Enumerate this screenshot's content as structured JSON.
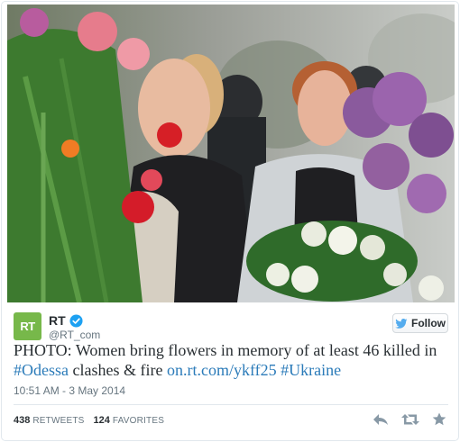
{
  "tweet": {
    "display_name": "RT",
    "handle": "@RT_com",
    "avatar_text": "RT",
    "follow_label": "Follow",
    "text_prefix": "PHOTO: Women bring flowers in memory of at least 46 killed in ",
    "hashtag_odessa": "#Odessa",
    "text_middle": " clashes & fire ",
    "url": "on.rt.com/ykff25",
    "text_space": " ",
    "hashtag_ukraine": "#Ukraine",
    "timestamp": "10:51 AM - 3 May 2014",
    "retweets_count": "438",
    "retweets_label": "RETWEETS",
    "favorites_count": "124",
    "favorites_label": "FAVORITES"
  },
  "colors": {
    "avatar_bg": "#77b84a",
    "link": "#2b7bb9",
    "verified": "#1da1f2",
    "bird": "#55acee",
    "text": "#292f33",
    "muted": "#66757f"
  },
  "icons": [
    "verified-icon",
    "bird-icon",
    "reply-icon",
    "retweet-icon",
    "favorite-icon"
  ]
}
